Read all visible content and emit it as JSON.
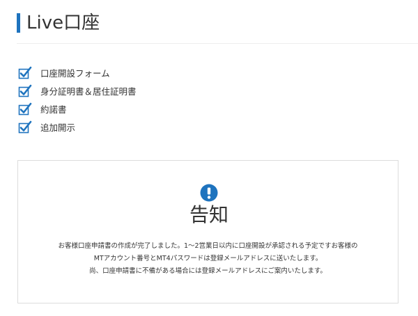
{
  "header": {
    "title": "Live口座"
  },
  "checklist": [
    {
      "label": "口座開設フォーム",
      "checked": true
    },
    {
      "label": "身分証明書＆居住証明書",
      "checked": true
    },
    {
      "label": "約諾書",
      "checked": true
    },
    {
      "label": "追加開示",
      "checked": true
    }
  ],
  "notice": {
    "icon": "exclamation-circle-icon",
    "title": "告知",
    "lines": [
      "お客様口座申請書の作成が完了しました。1～2営業日以内に口座開設が承認される予定ですお客様の",
      "MTアカウント番号とMT4パスワードは登録メールアドレスに送いたします。",
      "尚、口座申請書に不備がある場合には登録メールアドレスにご案内いたします。"
    ]
  },
  "colors": {
    "accent": "#1e73be",
    "check": "#1e73be",
    "text": "#333333",
    "border": "#dcdcdc"
  }
}
